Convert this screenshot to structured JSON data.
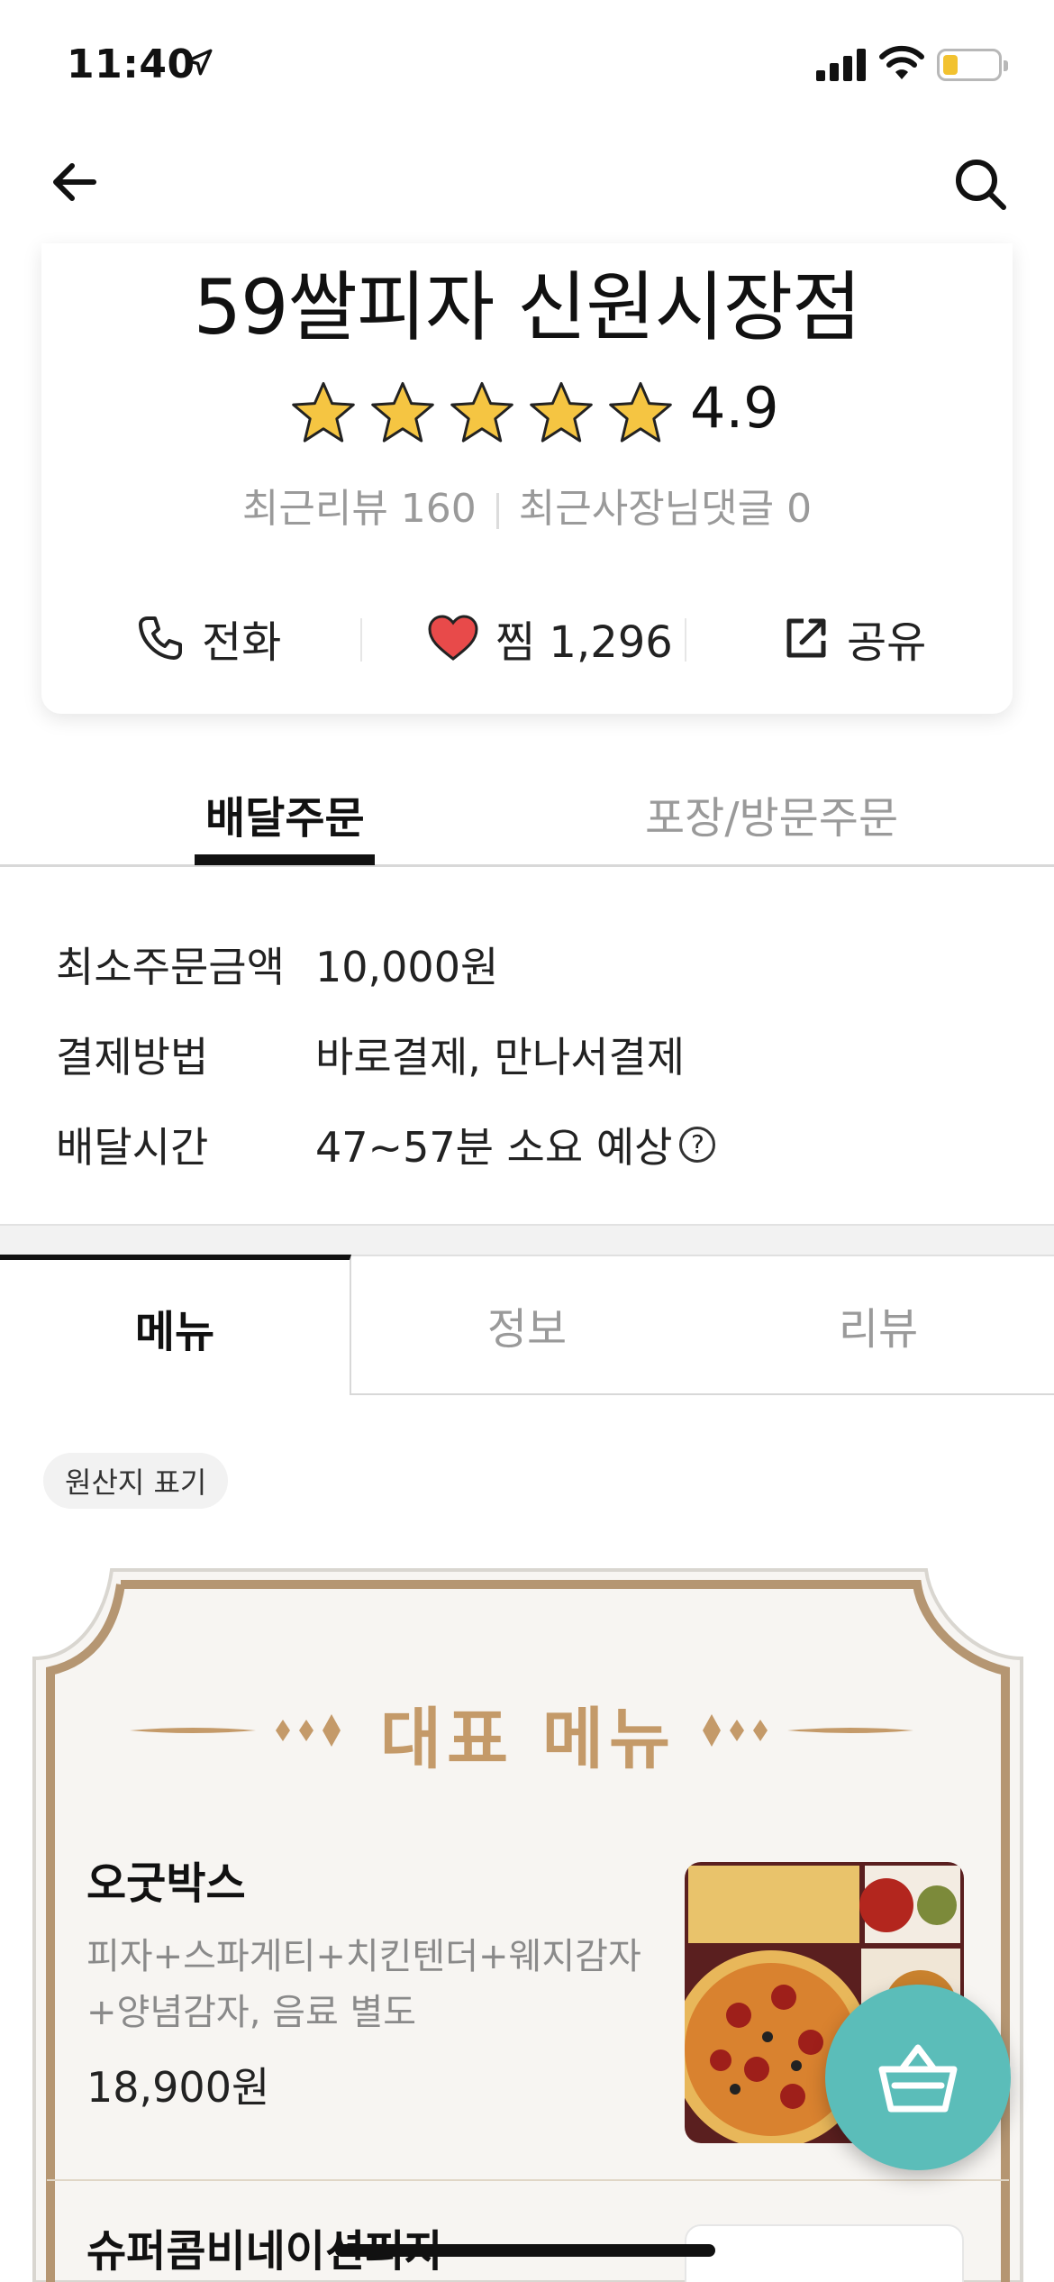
{
  "status_bar": {
    "time": "11:40"
  },
  "store": {
    "name": "59쌀피자 신원시장점",
    "rating": "4.9",
    "star_count": 5,
    "recent_reviews": "최근리뷰 160",
    "owner_replies": "최근사장님댓글 0"
  },
  "actions": {
    "call_label": "전화",
    "like_label": "찜 1,296",
    "share_label": "공유"
  },
  "order_tabs": {
    "delivery": "배달주문",
    "pickup": "포장/방문주문"
  },
  "info": {
    "min_order_label": "최소주문금액",
    "min_order_value": "10,000원",
    "payment_label": "결제방법",
    "payment_value": "바로결제, 만나서결제",
    "delivery_time_label": "배달시간",
    "delivery_time_value": "47~57분 소요 예상",
    "help_mark": "?"
  },
  "menu_tabs": {
    "menu": "메뉴",
    "info": "정보",
    "reviews": "리뷰"
  },
  "origin_badge": "원산지 표기",
  "featured": {
    "title": "대표 메뉴",
    "items": [
      {
        "name": "오굿박스",
        "desc_line1": "피자+스파게티+치킨텐더+웨지감자",
        "desc_line2": "+양념감자, 음료 별도",
        "price": "18,900원"
      },
      {
        "name": "슈퍼콤비네이션피자"
      }
    ]
  },
  "colors": {
    "accent_gold": "#c49a69",
    "cart_teal": "#5bbdb9",
    "star_yellow": "#f5c542",
    "heart_red": "#e84a4a"
  },
  "icons": [
    "location-arrow-icon",
    "signal-icon",
    "wifi-icon",
    "battery-icon",
    "back-arrow-icon",
    "search-icon",
    "star-icon",
    "phone-icon",
    "heart-icon",
    "share-icon",
    "help-icon",
    "cart-icon"
  ]
}
